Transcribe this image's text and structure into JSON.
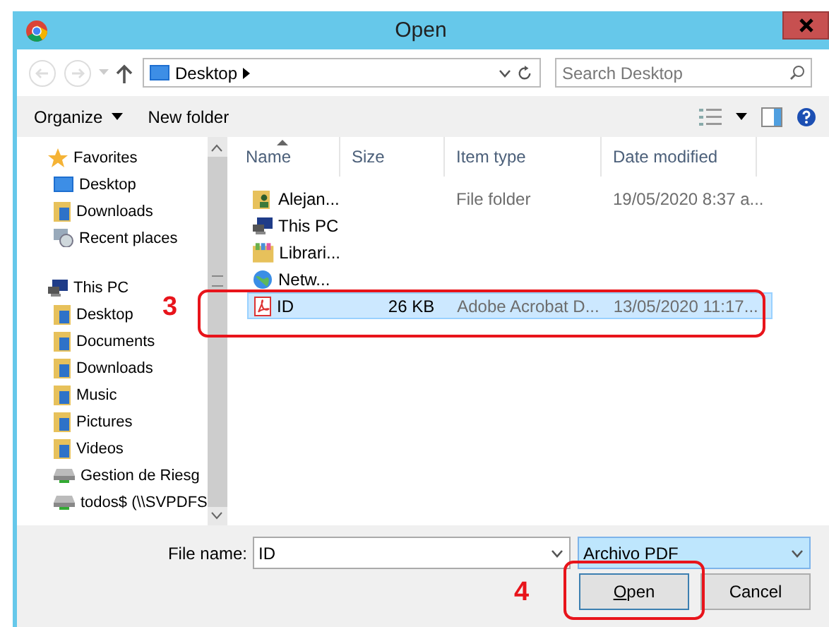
{
  "window": {
    "title": "Open"
  },
  "address": {
    "path": "Desktop"
  },
  "search": {
    "placeholder": "Search Desktop"
  },
  "toolbar": {
    "organize": "Organize",
    "new_folder": "New folder"
  },
  "sidebar": {
    "items": [
      {
        "label": "Favorites",
        "kind": "star",
        "children": [
          {
            "label": "Desktop",
            "kind": "desktop"
          },
          {
            "label": "Downloads",
            "kind": "folder"
          },
          {
            "label": "Recent places",
            "kind": "recent"
          }
        ]
      },
      {
        "label": "This PC",
        "kind": "pc",
        "children": [
          {
            "label": "Desktop",
            "kind": "folder"
          },
          {
            "label": "Documents",
            "kind": "folder"
          },
          {
            "label": "Downloads",
            "kind": "folder"
          },
          {
            "label": "Music",
            "kind": "folder"
          },
          {
            "label": "Pictures",
            "kind": "folder"
          },
          {
            "label": "Videos",
            "kind": "folder"
          },
          {
            "label": "Gestion de Riesg",
            "kind": "drive"
          },
          {
            "label": "todos$ (\\\\SVPDFS",
            "kind": "drive"
          }
        ]
      }
    ]
  },
  "files": {
    "columns": [
      {
        "label": "Name",
        "sorted": true
      },
      {
        "label": "Size",
        "sorted": false
      },
      {
        "label": "Item type",
        "sorted": false
      },
      {
        "label": "Date modified",
        "sorted": false
      }
    ],
    "rows": [
      {
        "name": "Alejan...",
        "kind": "user-folder",
        "type": "File folder",
        "date": "19/05/2020 8:37 a...",
        "selected": false
      },
      {
        "name": "This PC",
        "kind": "pc",
        "selected": false
      },
      {
        "name": "Librari...",
        "kind": "library",
        "selected": false
      },
      {
        "name": "Netw...",
        "kind": "network",
        "selected": false
      },
      {
        "name": "ID",
        "kind": "pdf",
        "size": "26 KB",
        "type": "Adobe Acrobat D...",
        "date": "13/05/2020 11:17...",
        "selected": true
      }
    ]
  },
  "file_name": {
    "label": "File name:",
    "value": "ID"
  },
  "file_type": {
    "value": "Archivo PDF"
  },
  "buttons": [
    {
      "label": "Open",
      "kind": "primary"
    },
    {
      "label": "Cancel",
      "kind": "secondary"
    }
  ],
  "annotations": [
    {
      "label": "3",
      "kind": "row"
    },
    {
      "label": "4",
      "kind": "button"
    }
  ]
}
